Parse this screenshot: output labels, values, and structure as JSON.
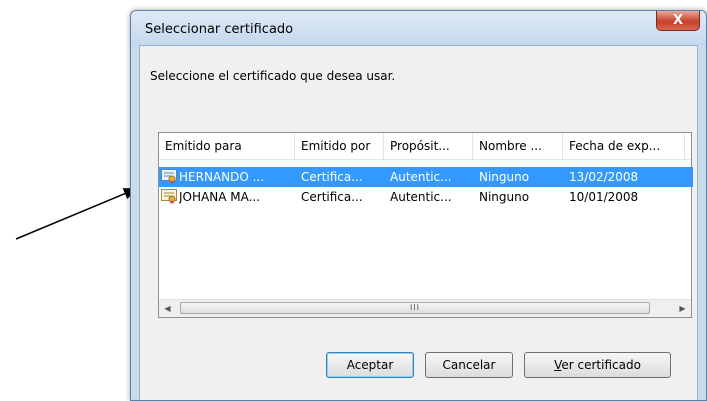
{
  "window": {
    "title": "Seleccionar certificado",
    "close_glyph": "X",
    "prompt": "Seleccione el certificado que desea usar."
  },
  "columns": [
    "Emitido para",
    "Emitido por",
    "Propósit...",
    "Nombre ...",
    "Fecha de exp..."
  ],
  "rows": [
    {
      "issued_to": "HERNANDO ...",
      "issued_by": "Certifica...",
      "purpose": "Autentic...",
      "name": "Ninguno",
      "expiry": "13/02/2008",
      "selected": true
    },
    {
      "issued_to": "JOHANA MA...",
      "issued_by": "Certifica...",
      "purpose": "Autentic...",
      "name": "Ninguno",
      "expiry": "10/01/2008",
      "selected": false
    }
  ],
  "scrollbar": {
    "left_arrow": "◀",
    "right_arrow": "▶",
    "grip": "III"
  },
  "buttons": {
    "ok": "Aceptar",
    "cancel": "Cancelar",
    "view_cert_access_key": "V",
    "view_cert_rest": "er certificado"
  },
  "icons": {
    "certificate": "certificate-icon"
  },
  "colors": {
    "selection": "#3399ff",
    "title_bar": "#c4d8ec",
    "close_button": "#c7402b"
  }
}
